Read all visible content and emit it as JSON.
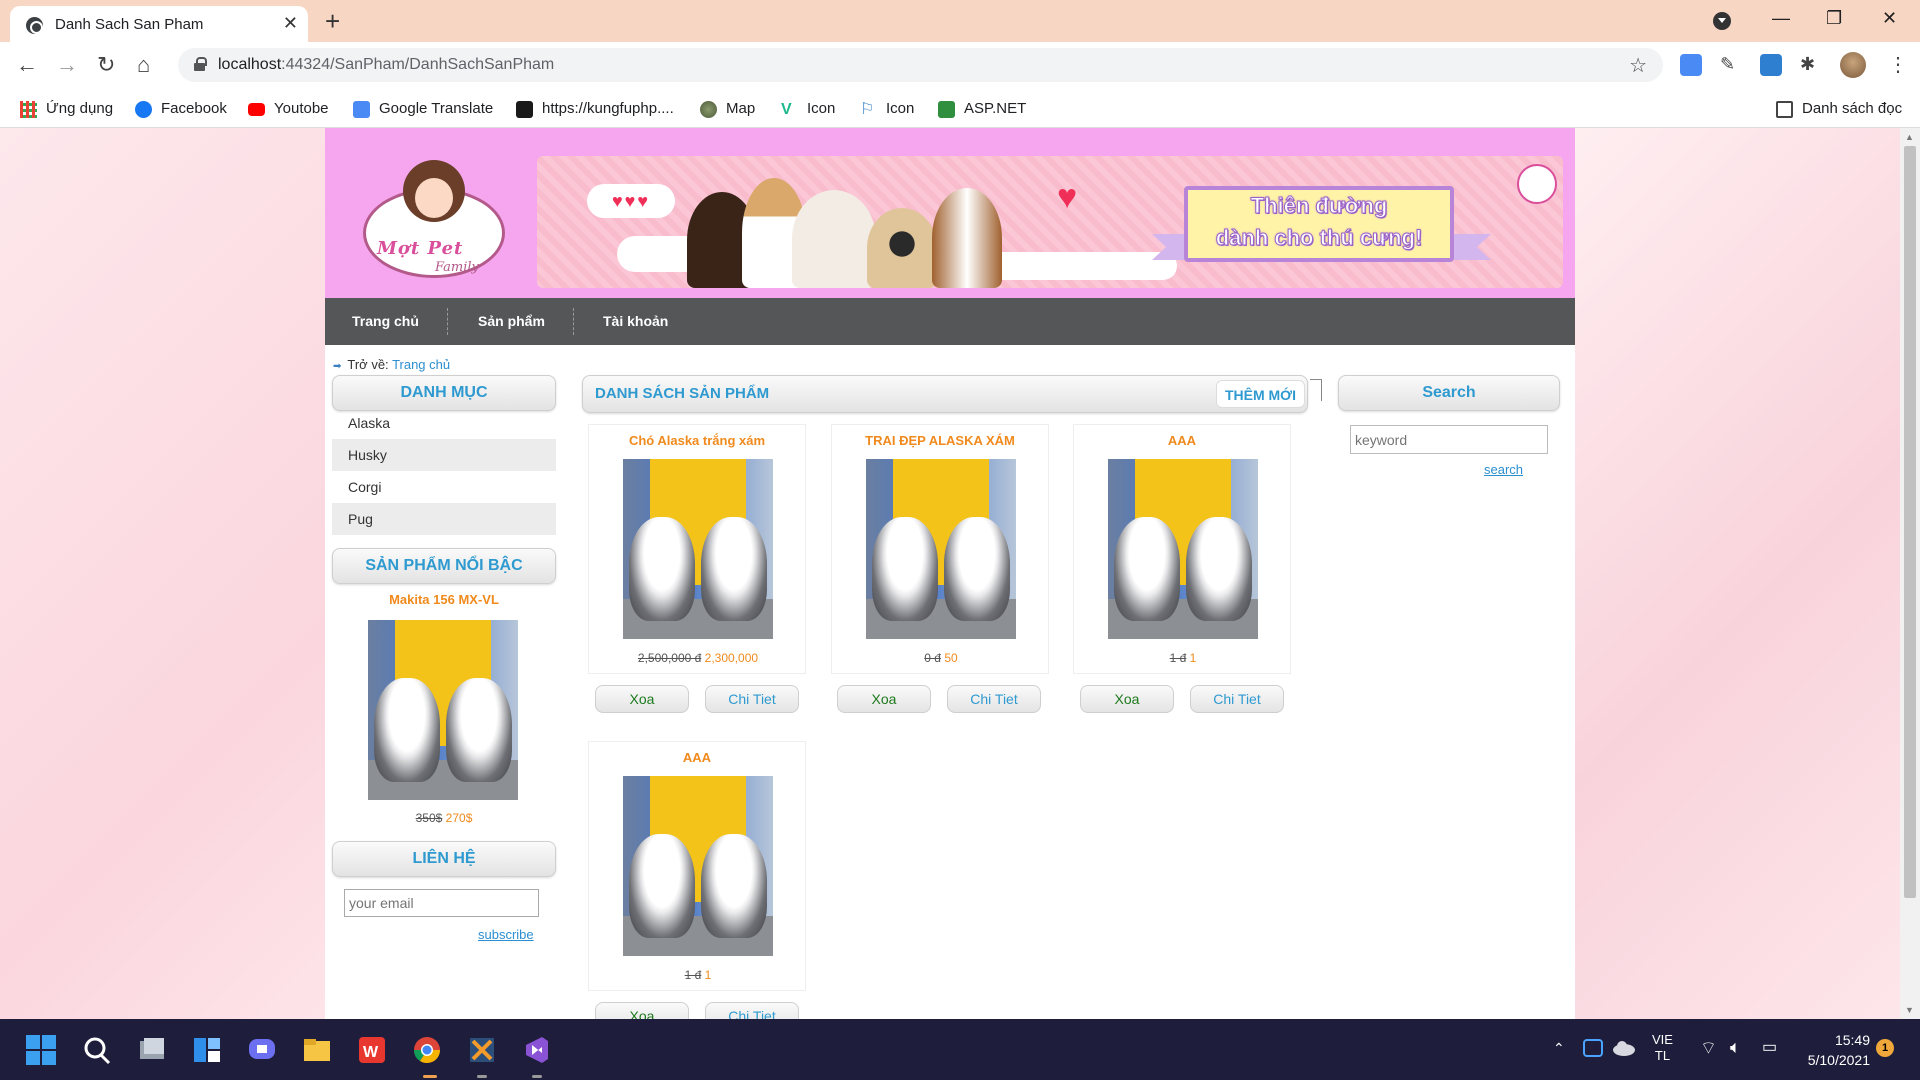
{
  "browser": {
    "tab_title": "Danh Sach San Pham",
    "url_host": "localhost",
    "url_rest": ":44324/SanPham/DanhSachSanPham",
    "bookmarks": [
      {
        "label": "Ứng dụng",
        "icon": "apps-grid-icon"
      },
      {
        "label": "Facebook",
        "icon": "facebook-icon"
      },
      {
        "label": "Youtobe",
        "icon": "youtube-icon"
      },
      {
        "label": "Google Translate",
        "icon": "google-translate-icon"
      },
      {
        "label": "https://kungfuphp....",
        "icon": "kungfuphp-icon"
      },
      {
        "label": "Map",
        "icon": "map-icon"
      },
      {
        "label": "Icon",
        "icon": "vuetify-icon"
      },
      {
        "label": "Icon",
        "icon": "flag-icon"
      },
      {
        "label": "ASP.NET",
        "icon": "aspnet-icon"
      }
    ],
    "reading_list": "Danh sách đọc"
  },
  "site": {
    "logo": {
      "title": "Mợt Pet",
      "subtitle": "Family"
    },
    "banner": {
      "line1": "Thiên đường",
      "line2": "dành cho thú cưng!"
    },
    "nav": [
      "Trang chủ",
      "Sản phẩm",
      "Tài khoản"
    ],
    "breadcrumb": {
      "prefix": "Trở về:",
      "link": "Trang chủ"
    },
    "sidebar": {
      "category_heading": "DANH MỤC",
      "categories": [
        "Alaska",
        "Husky",
        "Corgi",
        "Pug"
      ],
      "featured_heading": "SẢN PHẨM NỔI BẬC",
      "featured": {
        "name": "Makita 156 MX-VL",
        "old_price": "350$",
        "new_price": "270$"
      },
      "contact_heading": "LIÊN HỆ",
      "email_placeholder": "your email",
      "subscribe": "subscribe"
    },
    "main": {
      "heading": "DANH SÁCH SẢN PHẨM",
      "add_button": "THÊM MỚI",
      "delete_label": "Xoa",
      "detail_label": "Chi Tiet",
      "products": [
        {
          "name": "Chó Alaska trắng xám",
          "old_price": "2,500,000 đ",
          "new_price": "2,300,000"
        },
        {
          "name": "TRAI ĐẸP ALASKA XÁM",
          "old_price": "0 đ",
          "new_price": "50"
        },
        {
          "name": "AAA",
          "old_price": "1 đ",
          "new_price": "1"
        },
        {
          "name": "AAA",
          "old_price": "1 đ",
          "new_price": "1"
        }
      ]
    },
    "search": {
      "heading": "Search",
      "placeholder": "keyword",
      "button": "search"
    }
  },
  "taskbar": {
    "lang_top": "VIE",
    "lang_bottom": "TL",
    "time": "15:49",
    "date": "5/10/2021",
    "notifications": "1"
  },
  "colors": {
    "header_pink": "#f6a6ee",
    "nav_gray": "#555658",
    "accent_blue": "#2e9ad0",
    "price_orange": "#f08a1d"
  }
}
